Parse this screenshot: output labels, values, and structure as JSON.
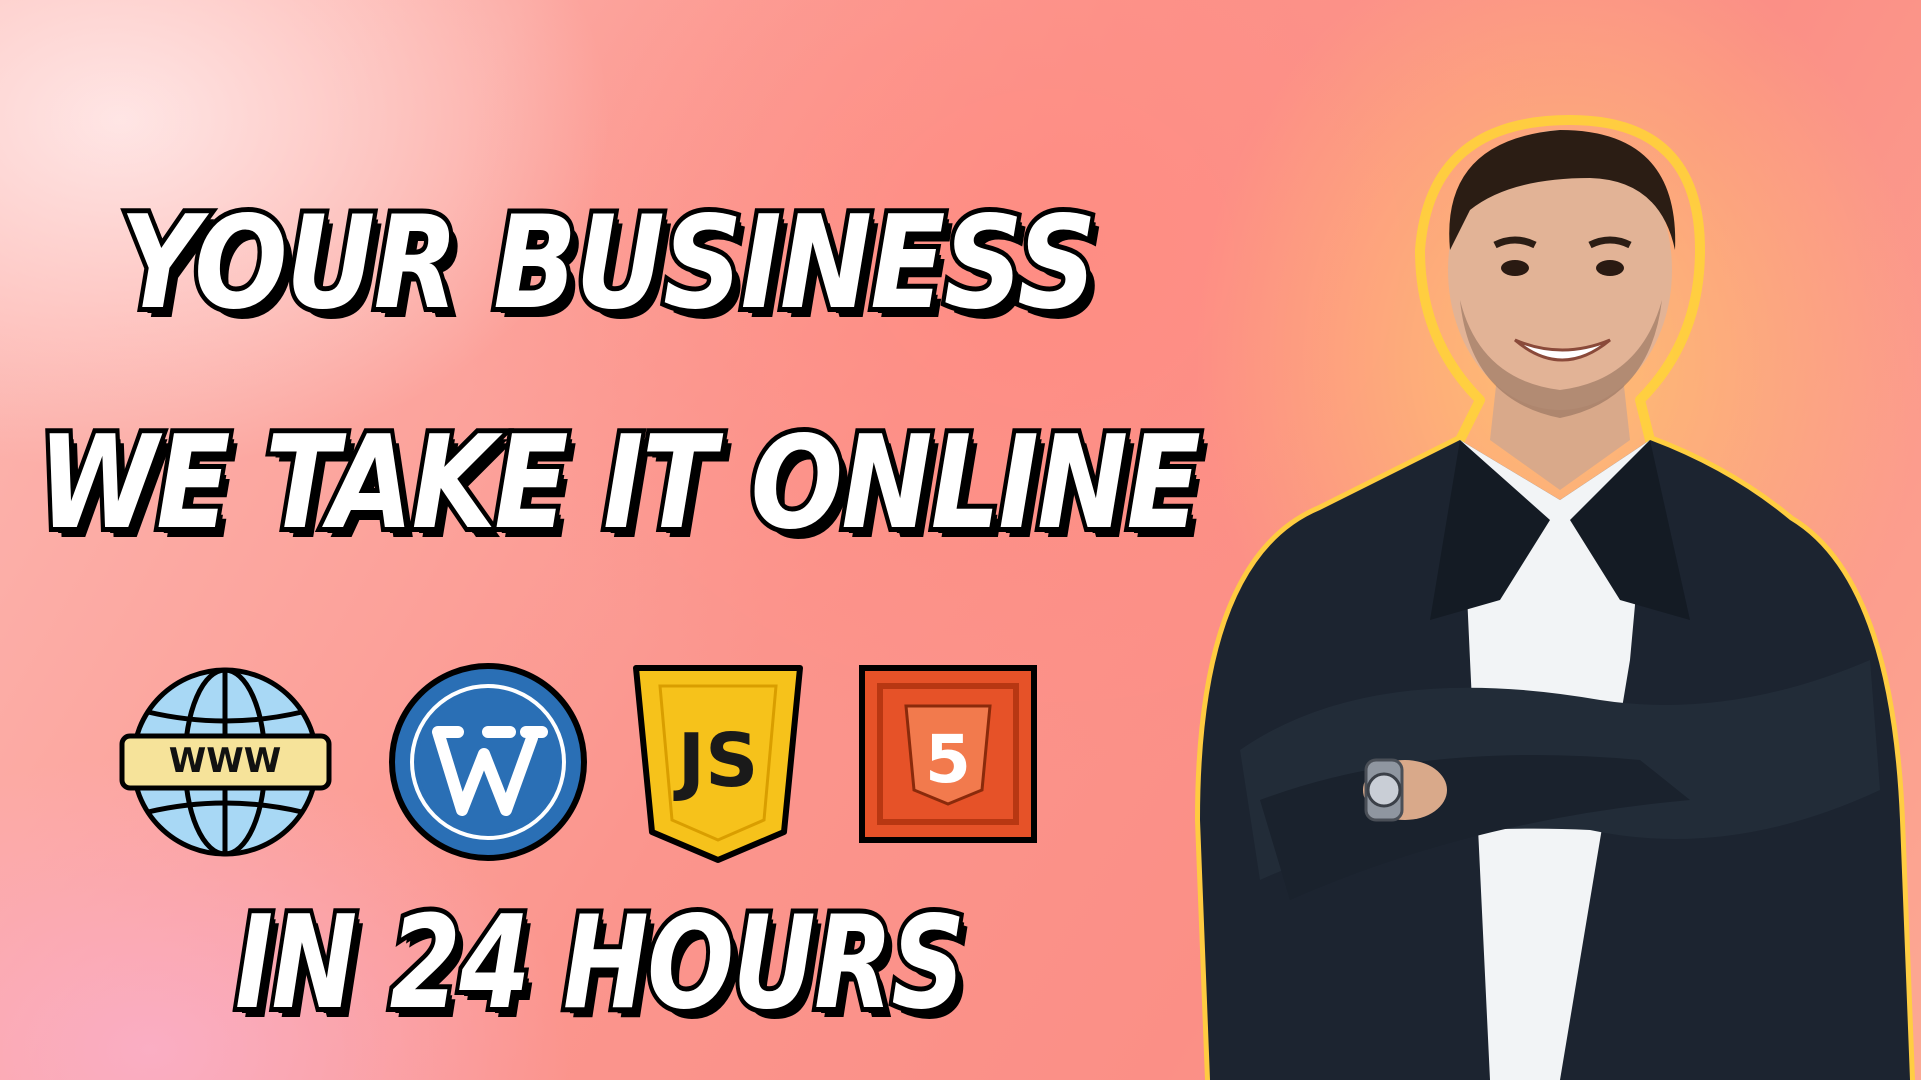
{
  "headline": {
    "line1": "YOUR BUSINESS",
    "line2": "WE TAKE IT ONLINE",
    "line3": "IN 24 HOURS"
  },
  "icons": [
    {
      "name": "www-globe-icon",
      "label": "WWW"
    },
    {
      "name": "wordpress-icon"
    },
    {
      "name": "javascript-icon",
      "label": "JS"
    },
    {
      "name": "html5-icon",
      "label": "5"
    }
  ],
  "colors": {
    "text": "#ffffff",
    "outline": "#000000",
    "globe": "#a8d8f5",
    "www_bar": "#f6e39a",
    "wordpress": "#2a6fb5",
    "js": "#f6c21b",
    "html5": "#e65228",
    "suit": "#1c2430"
  }
}
